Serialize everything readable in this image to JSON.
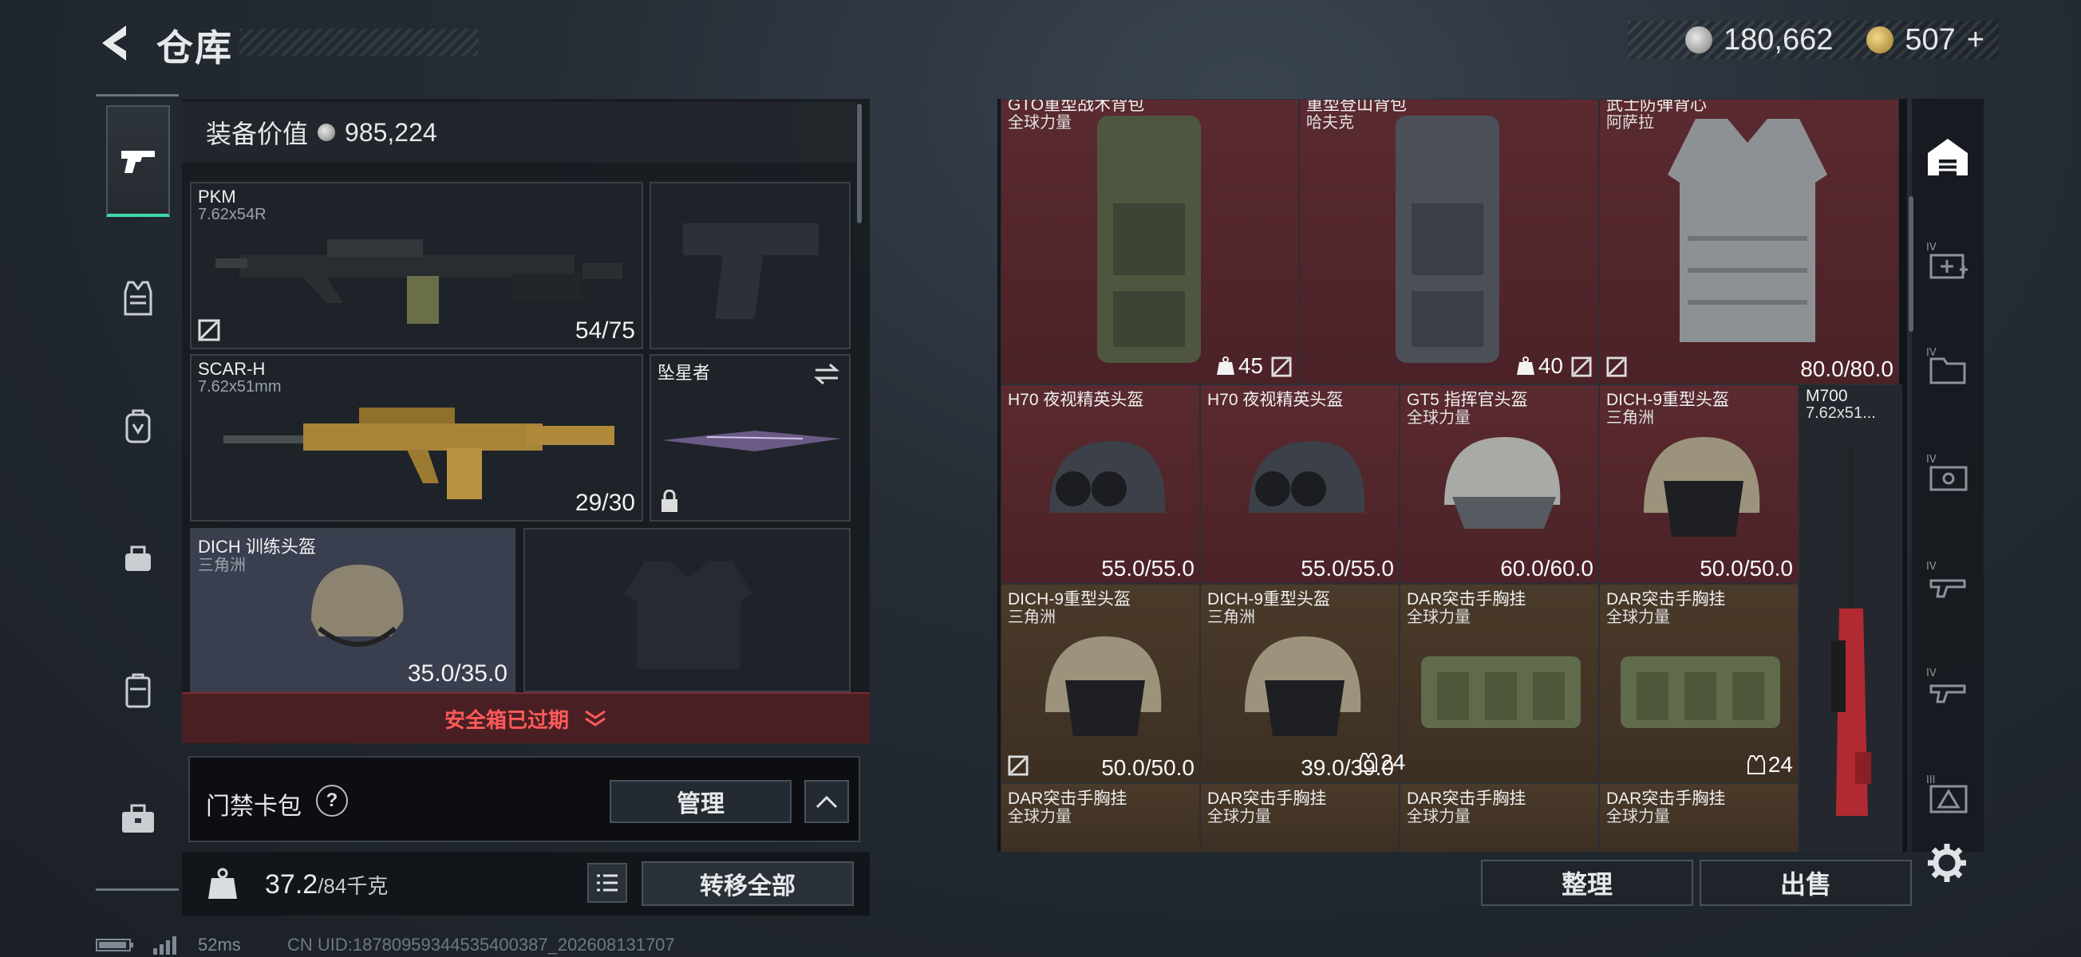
{
  "header": {
    "title": "仓库",
    "currency": {
      "silver": "180,662",
      "gold": "507",
      "plus": "+"
    }
  },
  "equipment": {
    "value_label": "装备价值",
    "value": "985,224",
    "slots": {
      "primary1": {
        "name": "PKM",
        "sub": "7.62x54R",
        "ammo": "54/75"
      },
      "primary2": {
        "name": "SCAR-H",
        "sub": "7.62x51mm",
        "ammo": "29/30"
      },
      "melee": {
        "name": "坠星者"
      },
      "helmet": {
        "name": "DICH 训练头盔",
        "sub": "三角洲",
        "durability": "35.0/35.0"
      }
    },
    "safe_box_status": "安全箱已过期",
    "card_bag": {
      "label": "门禁卡包",
      "help": "?",
      "manage": "管理"
    },
    "weight": {
      "current": "37.2",
      "max": "/84千克",
      "kg": "KG"
    },
    "transfer_all": "转移全部"
  },
  "status": {
    "ping": "52ms",
    "uid": "CN UID:18780959344535400387_202608131707"
  },
  "stash": {
    "row1": [
      {
        "name": "GTO重型战术背包",
        "sub": "全球力量",
        "tag": "45"
      },
      {
        "name": "重型登山背包",
        "sub": "哈夫克",
        "tag": "40"
      },
      {
        "name": "武士防弹背心",
        "sub": "阿萨拉",
        "value": "80.0/80.0"
      }
    ],
    "row2": [
      {
        "name": "H70 夜视精英头盔",
        "sub": "",
        "value": "55.0/55.0"
      },
      {
        "name": "H70 夜视精英头盔",
        "sub": "",
        "value": "55.0/55.0"
      },
      {
        "name": "GT5 指挥官头盔",
        "sub": "全球力量",
        "value": "60.0/60.0"
      },
      {
        "name": "DICH-9重型头盔",
        "sub": "三角洲",
        "value": "50.0/50.0"
      }
    ],
    "row3": [
      {
        "name": "DICH-9重型头盔",
        "sub": "三角洲",
        "value": "50.0/50.0"
      },
      {
        "name": "DICH-9重型头盔",
        "sub": "三角洲",
        "value": "39.0/39.0"
      },
      {
        "name": "DAR突击手胸挂",
        "sub": "全球力量",
        "tag": ""
      },
      {
        "name": "DAR突击手胸挂",
        "sub": "全球力量",
        "tag": "24"
      }
    ],
    "third_tag": "24",
    "row4": [
      {
        "name": "DAR突击手胸挂",
        "sub": "全球力量"
      },
      {
        "name": "DAR突击手胸挂",
        "sub": "全球力量"
      },
      {
        "name": "DAR突击手胸挂",
        "sub": "全球力量"
      },
      {
        "name": "DAR突击手胸挂",
        "sub": "全球力量"
      }
    ],
    "rifle": {
      "name": "M700",
      "sub": "7.62x51..."
    }
  },
  "actions": {
    "organize": "整理",
    "sell": "出售"
  },
  "tools": [
    "IV",
    "IV",
    "IV",
    "IV",
    "IV",
    "III"
  ]
}
